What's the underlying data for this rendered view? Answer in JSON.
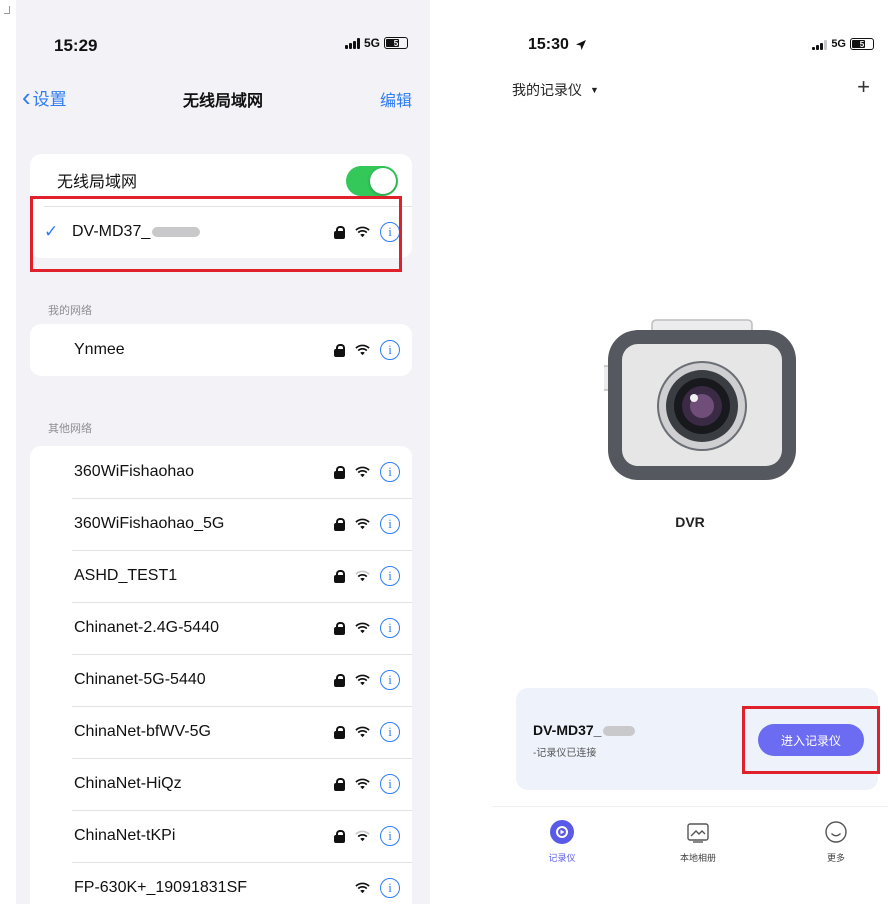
{
  "left": {
    "status": {
      "time": "15:29",
      "network": "5G",
      "battery": "5"
    },
    "nav": {
      "back_label": "设置",
      "title": "无线局域网",
      "edit_label": "编辑"
    },
    "wifi_toggle": {
      "label": "无线局域网",
      "on": true
    },
    "connected": {
      "name": "DV-MD37_"
    },
    "my_networks": {
      "header": "我的网络",
      "items": [
        {
          "name": "Ynmee"
        }
      ]
    },
    "other_networks": {
      "header": "其他网络",
      "items": [
        {
          "name": "360WiFishaohao"
        },
        {
          "name": "360WiFishaohao_5G"
        },
        {
          "name": "ASHD_TEST1"
        },
        {
          "name": "Chinanet-2.4G-5440"
        },
        {
          "name": "Chinanet-5G-5440"
        },
        {
          "name": "ChinaNet-bfWV-5G"
        },
        {
          "name": "ChinaNet-HiQz"
        },
        {
          "name": "ChinaNet-tKPi"
        },
        {
          "name": "FP-630K+_19091831SF"
        }
      ]
    }
  },
  "right": {
    "status": {
      "time": "15:30",
      "network": "5G",
      "battery": "5"
    },
    "device_selector": "我的记录仪",
    "device_label": "DVR",
    "card": {
      "name": "DV-MD37_",
      "status": "-记录仪已连接",
      "button": "进入记录仪"
    },
    "tabs": [
      {
        "label": "记录仪",
        "icon": "recorder-icon"
      },
      {
        "label": "本地相册",
        "icon": "album-icon"
      },
      {
        "label": "更多",
        "icon": "more-icon"
      }
    ]
  },
  "colors": {
    "accent_blue": "#2f7cf6",
    "toggle_green": "#34c759",
    "highlight_red": "#e0202a",
    "button_purple": "#6c6cf2"
  }
}
